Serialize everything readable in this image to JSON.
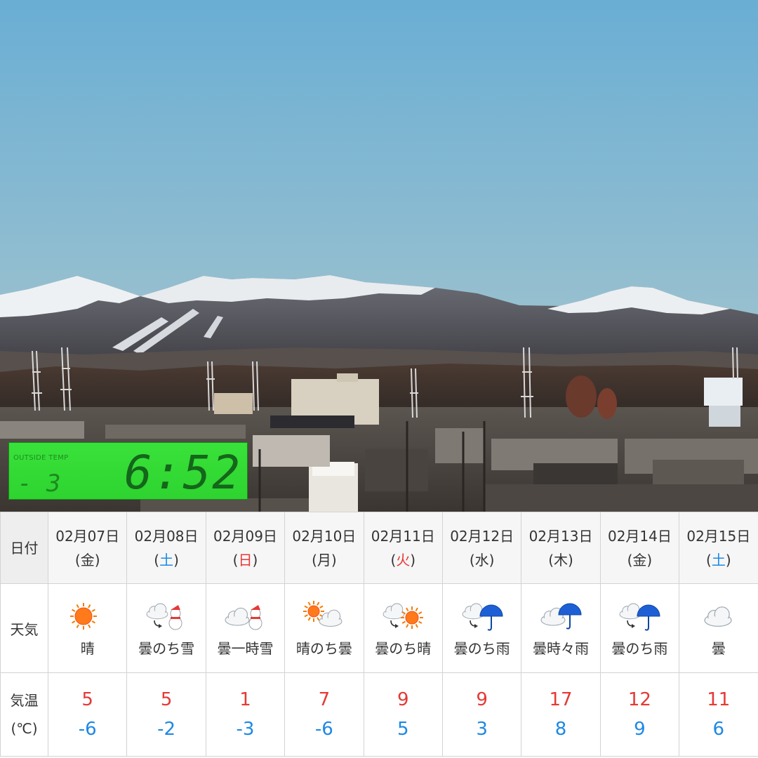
{
  "lcd": {
    "label": "OUTSIDE TEMP",
    "temp": "- 3",
    "time": "6:52"
  },
  "forecast": {
    "row_labels": {
      "date": "日付",
      "weather": "天気",
      "temp_line1": "気温",
      "temp_line2": "(℃)"
    },
    "days": [
      {
        "date": "02月07日",
        "dow": "(金)",
        "dow_color": "normal",
        "icon": "sun-icon",
        "weather": "晴",
        "max": "5",
        "min": "-6"
      },
      {
        "date": "02月08日",
        "dow": "(土)",
        "dow_color": "blue",
        "icon": "cloud-then-snow-icon",
        "weather": "曇のち雪",
        "max": "5",
        "min": "-2"
      },
      {
        "date": "02月09日",
        "dow": "(日)",
        "dow_color": "red",
        "icon": "cloud-sometimes-snow-icon",
        "weather": "曇一時雪",
        "max": "1",
        "min": "-3"
      },
      {
        "date": "02月10日",
        "dow": "(月)",
        "dow_color": "normal",
        "icon": "sun-then-cloud-icon",
        "weather": "晴のち曇",
        "max": "7",
        "min": "-6"
      },
      {
        "date": "02月11日",
        "dow": "(火)",
        "dow_color": "red",
        "icon": "cloud-then-sun-icon",
        "weather": "曇のち晴",
        "max": "9",
        "min": "5"
      },
      {
        "date": "02月12日",
        "dow": "(水)",
        "dow_color": "normal",
        "icon": "cloud-then-rain-icon",
        "weather": "曇のち雨",
        "max": "9",
        "min": "3"
      },
      {
        "date": "02月13日",
        "dow": "(木)",
        "dow_color": "normal",
        "icon": "cloud-sometimes-rain-icon",
        "weather": "曇時々雨",
        "max": "17",
        "min": "8"
      },
      {
        "date": "02月14日",
        "dow": "(金)",
        "dow_color": "normal",
        "icon": "cloud-then-rain-icon",
        "weather": "曇のち雨",
        "max": "12",
        "min": "9"
      },
      {
        "date": "02月15日",
        "dow": "(土)",
        "dow_color": "blue",
        "icon": "cloud-icon",
        "weather": "曇",
        "max": "11",
        "min": "6"
      }
    ]
  },
  "colors": {
    "sky_top": "#6aaed4",
    "sky_bottom": "#a6c8c6",
    "max_temp": "#e53935",
    "min_temp": "#1e88e5",
    "lcd_green": "#33dd33"
  }
}
